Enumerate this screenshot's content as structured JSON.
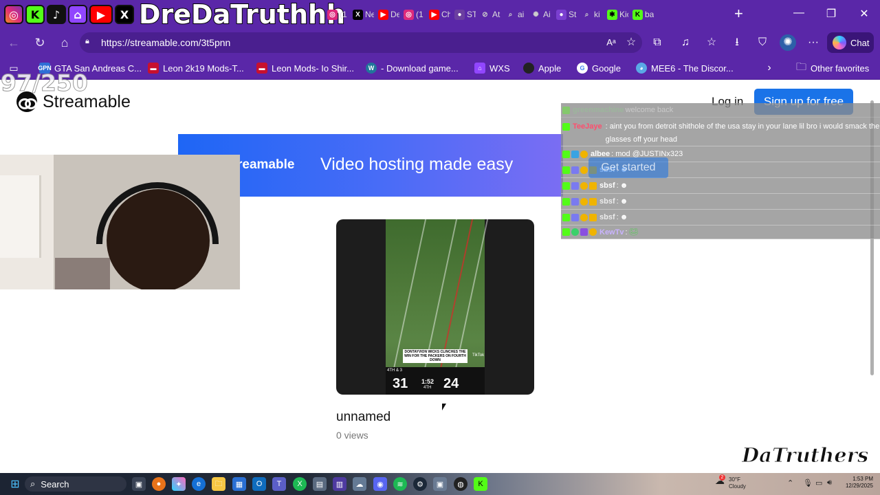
{
  "stream_overlay": {
    "channel_name": "DreDaTruthhh",
    "counter": "97/250",
    "watermark": "DaTruthers"
  },
  "browser": {
    "tabs": [
      {
        "label": "(1"
      },
      {
        "label": "Ne"
      },
      {
        "label": "De"
      },
      {
        "label": "(1"
      },
      {
        "label": "Ch"
      },
      {
        "label": "ST"
      },
      {
        "label": "At"
      },
      {
        "label": "ai"
      },
      {
        "label": "Ai"
      },
      {
        "label": "St"
      },
      {
        "label": "ki"
      },
      {
        "label": "Kic"
      },
      {
        "label": "ba"
      }
    ],
    "url": "https://streamable.com/3t5pnn",
    "chat_label": "Chat",
    "bookmarks": [
      {
        "label": "GTA San Andreas C...",
        "color": "#2f6fd6",
        "icon": "GPN"
      },
      {
        "label": "Leon 2k19 Mods-T...",
        "color": "#c8102e",
        "icon": ""
      },
      {
        "label": "Leon Mods- Io Shir...",
        "color": "#c8102e",
        "icon": ""
      },
      {
        "label": "- Download game...",
        "color": "#21759b",
        "icon": "W"
      },
      {
        "label": "WXS",
        "color": "#9146ff",
        "icon": ""
      },
      {
        "label": "Apple",
        "color": "#222",
        "icon": ""
      },
      {
        "label": "Google",
        "color": "#fff",
        "icon": "G"
      },
      {
        "label": "MEE6 - The Discor...",
        "color": "#5aa9e6",
        "icon": ""
      }
    ],
    "other_favorites": "Other favorites"
  },
  "page": {
    "logo_text": "Streamable",
    "login": "Log in",
    "signup": "Sign up for free",
    "banner_brand": "reamable",
    "banner_tagline": "Video hosting made easy",
    "get_started": "Get started",
    "video": {
      "title": "unnamed",
      "views": "0 views",
      "caption": "DONTAYVION WICKS CLINCHES THE WIN FOR THE PACKERS ON FOURTH DOWN",
      "score_left": "31",
      "score_right": "24",
      "game_clock": "1:52",
      "quarter": "4TH",
      "down": "4TH & 3",
      "watermark": "TikTok"
    }
  },
  "chat": [
    {
      "user": "greenmachine",
      "message": "welcome back",
      "color": "#8fd18f"
    },
    {
      "user": "TeeJaye",
      "message": ": aint you from detroit shithole of the usa stay in your lane lil bro i would smack the glasses off your head",
      "color": "#ff4d6d"
    },
    {
      "user": "albee",
      "message": ": mod @JUSTINx323",
      "color": "#ffffff"
    },
    {
      "user": "sbsf",
      "message": ":",
      "color": "#ffffff"
    },
    {
      "user": "sbsf",
      "message": ":",
      "color": "#ffffff"
    },
    {
      "user": "sbsf",
      "message": ":",
      "color": "#ffffff"
    },
    {
      "user": "sbsf",
      "message": ":",
      "color": "#ffffff"
    },
    {
      "user": "KewTv",
      "message": ":",
      "color": "#c9b3ff"
    }
  ],
  "taskbar": {
    "search_label": "Search",
    "temperature": "30°F",
    "condition": "Cloudy",
    "time": "1:53 PM",
    "date": "12/29/2025",
    "notification_count": "2"
  }
}
